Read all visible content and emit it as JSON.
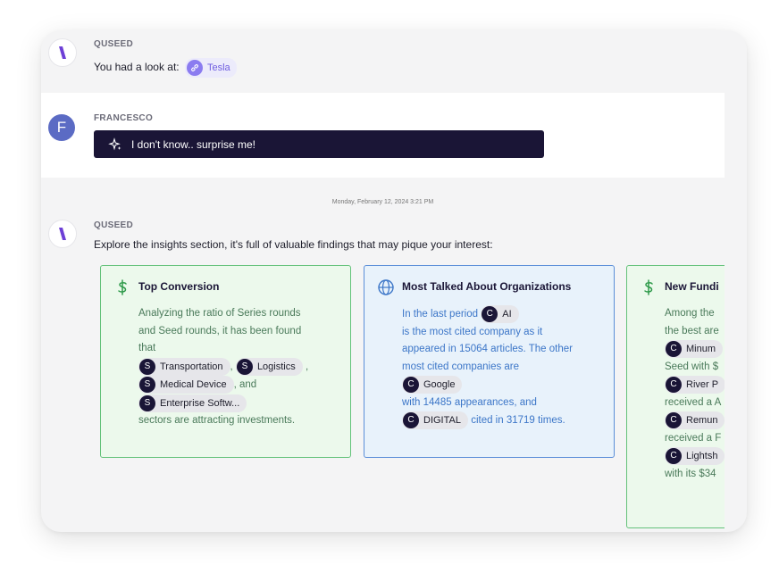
{
  "messages": {
    "first": {
      "sender": "QUSEED",
      "text": "You had a look at:",
      "chip": "Tesla"
    },
    "second": {
      "sender": "FRANCESCO",
      "avatar_letter": "F",
      "prompt": "I don't know.. surprise me!"
    },
    "timestamp": "Monday, February 12, 2024 3:21 PM",
    "third": {
      "sender": "QUSEED",
      "text": "Explore the insights section, it's full of valuable findings that may pique your interest:"
    }
  },
  "cards": {
    "top_conversion": {
      "title": "Top Conversion",
      "l1": "Analyzing the ratio of Series rounds",
      "l2": "and Seed rounds, it has been found",
      "l3": "that",
      "tag1": "Transportation",
      "tag2": "Logistics",
      "sep1": ",",
      "sep2": ",",
      "tag3": "Medical Device",
      "and": ", and",
      "tag4": "Enterprise Softw...",
      "l_end": "sectors are attracting investments.",
      "badge": "S"
    },
    "most_talked": {
      "title": "Most Talked About Organizations",
      "l1": "In the last period",
      "tag_ai": "AI",
      "l2": "is the most cited company as it",
      "l3": "appeared in 15064 articles. The other",
      "l4": "most cited companies are",
      "tag_google": "Google",
      "l5": "with 14485 appearances, and",
      "tag_digital": "DIGITAL",
      "l6": "cited in 31719 times.",
      "badge": "C"
    },
    "new_funding": {
      "title": "New Fundi",
      "l1": "Among the",
      "l2": "the best are",
      "tag1": "Minum",
      "l3": "Seed with $",
      "tag2": "River P",
      "l4": "received a A",
      "tag3": "Remun",
      "l5": "received a F",
      "tag4": "Lightsh",
      "l6": "with its $34",
      "badge": "C"
    }
  },
  "colors": {
    "accent_dark": "#1a1536",
    "green_border": "#64c27a",
    "blue_border": "#5b8ed8",
    "chip_purple": "#6e5ce0"
  }
}
